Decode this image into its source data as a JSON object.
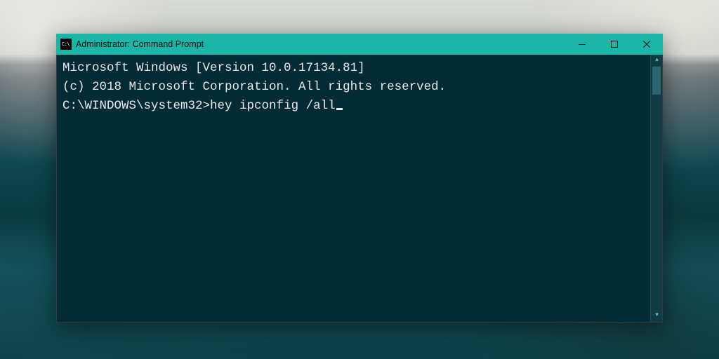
{
  "window": {
    "title": "Administrator: Command Prompt",
    "icon_label": "C:\\",
    "accent_color": "#1bb6a8"
  },
  "terminal": {
    "line1": "Microsoft Windows [Version 10.0.17134.81]",
    "line2": "(c) 2018 Microsoft Corporation. All rights reserved.",
    "blank": "",
    "prompt": "C:\\WINDOWS\\system32>",
    "command": "hey ipconfig /all"
  }
}
